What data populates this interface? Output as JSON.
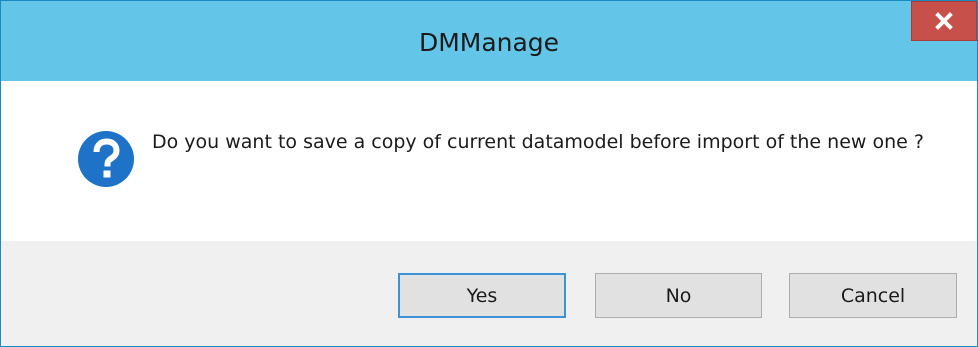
{
  "window": {
    "title": "DMManage",
    "close_icon": "close-icon"
  },
  "dialog": {
    "icon": "question-icon",
    "message": "Do you want to save a copy of current datamodel before import of the new one ?"
  },
  "buttons": {
    "yes": "Yes",
    "no": "No",
    "cancel": "Cancel"
  },
  "colors": {
    "titlebar": "#63c6e9",
    "close_button": "#c7504b",
    "icon_blue": "#1e73c8",
    "footer": "#f0f0f0",
    "default_button_border": "#3c93d6"
  }
}
